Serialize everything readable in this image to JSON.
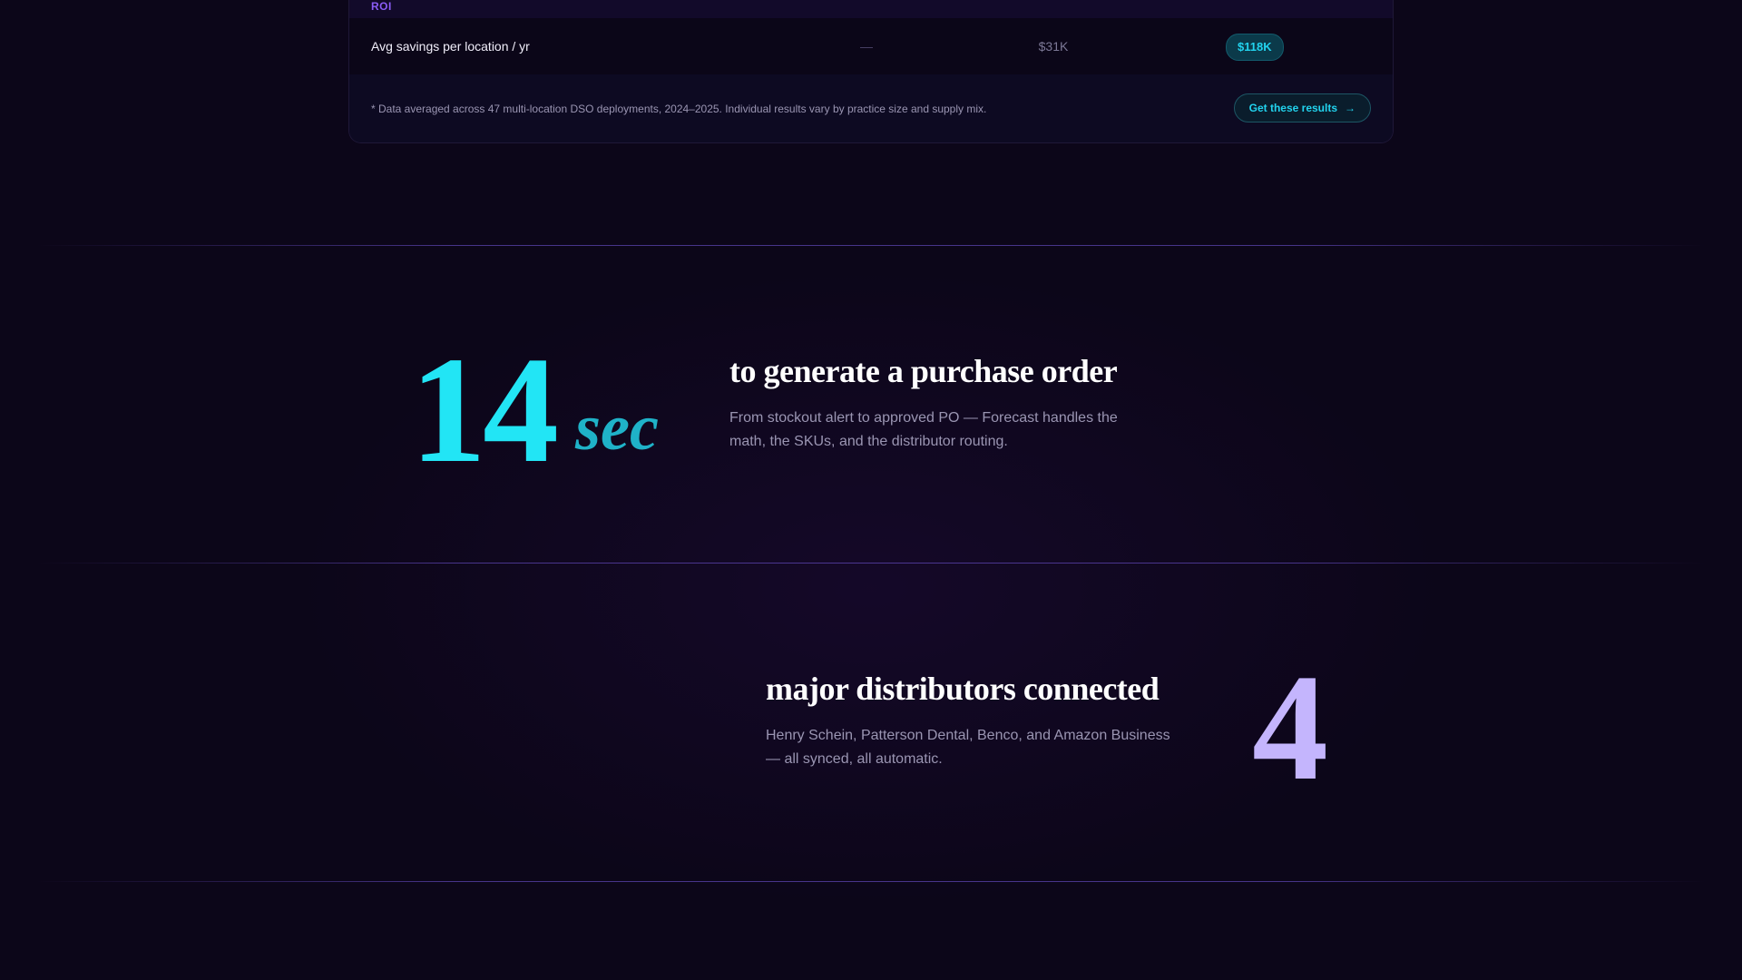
{
  "comparison_table": {
    "section_label": "ROI",
    "row": {
      "label": "Avg savings per location / yr",
      "before_value": "—",
      "competitor_value": "$31K",
      "forecast_value": "$118K"
    },
    "footnote": "* Data averaged across 47 multi-location DSO deployments, 2024–2025. Individual results vary by practice size and supply mix.",
    "cta": {
      "label": "Get these results",
      "icon": "arrow-right-icon",
      "arrow_glyph": "→"
    }
  },
  "stats": [
    {
      "number": "14",
      "unit": "sec",
      "heading": "to generate a purchase order",
      "description": "From stockout alert to approved PO — Forecast handles the math, the SKUs, and the distributor routing."
    },
    {
      "number": "4",
      "heading": "major distributors connected",
      "description": "Henry Schein, Patterson Dental, Benco, and Amazon Business — all synced, all automatic."
    }
  ],
  "colors": {
    "background": "#0c0619",
    "accent_cyan": "#22e5f5",
    "accent_violet": "#c4b5fd",
    "label_purple": "#8b5cf6"
  }
}
